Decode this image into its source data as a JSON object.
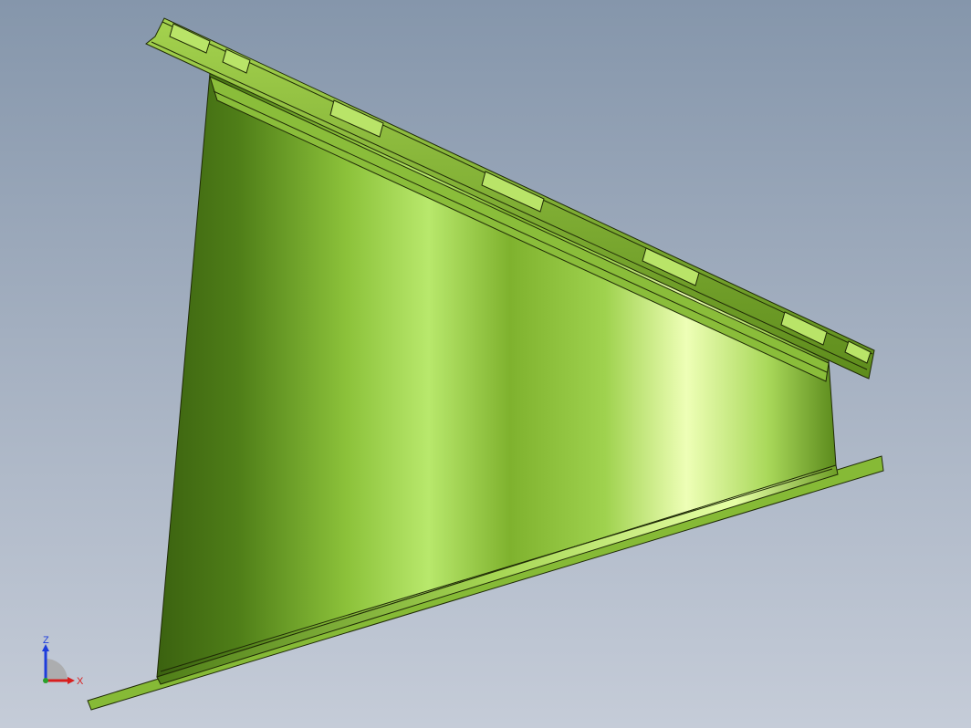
{
  "viewport": {
    "background_top": "#8596ab",
    "background_bottom": "#c5ccd8"
  },
  "model": {
    "part_color": "#7fb22e",
    "part_highlight": "#e8ffa8",
    "part_shadow": "#3d6410",
    "edge_color": "#1f2a06"
  },
  "triad": {
    "z_label": "Z",
    "x_label": "X",
    "z_color": "#1e3ddc",
    "x_color": "#d81e1e",
    "origin_color": "#2aa02a"
  }
}
